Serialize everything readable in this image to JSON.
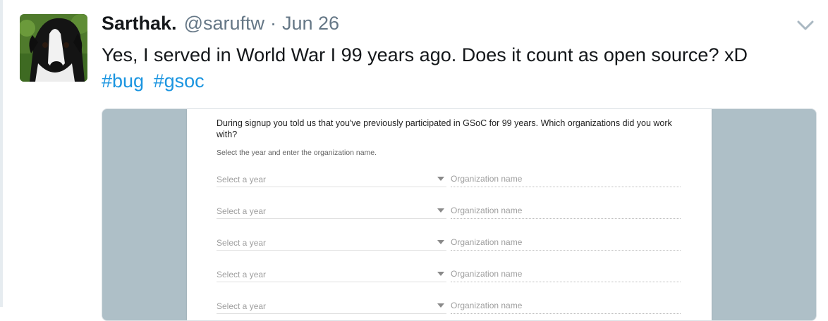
{
  "tweet": {
    "display_name": "Sarthak.",
    "handle": "@saruftw",
    "separator": "·",
    "date": "Jun 26",
    "text": "Yes, I served in World War I 99 years ago. Does it count as open source? xD",
    "hashtags": [
      "#bug",
      "#gsoc"
    ],
    "menu_icon": "chevron-down-icon",
    "avatar_icon": "dog-avatar"
  },
  "media": {
    "question": "During signup you told us that you've previously participated in GSoC for 99 years. Which organizations did you work with?",
    "instruction": "Select the year and enter the organization name.",
    "rows": [
      {
        "year_placeholder": "Select a year",
        "org_placeholder": "Organization name"
      },
      {
        "year_placeholder": "Select a year",
        "org_placeholder": "Organization name"
      },
      {
        "year_placeholder": "Select a year",
        "org_placeholder": "Organization name"
      },
      {
        "year_placeholder": "Select a year",
        "org_placeholder": "Organization name"
      },
      {
        "year_placeholder": "Select a year",
        "org_placeholder": "Organization name"
      }
    ]
  },
  "colors": {
    "link": "#1b95e0",
    "muted": "#657786",
    "media_background": "#aebfc7"
  }
}
